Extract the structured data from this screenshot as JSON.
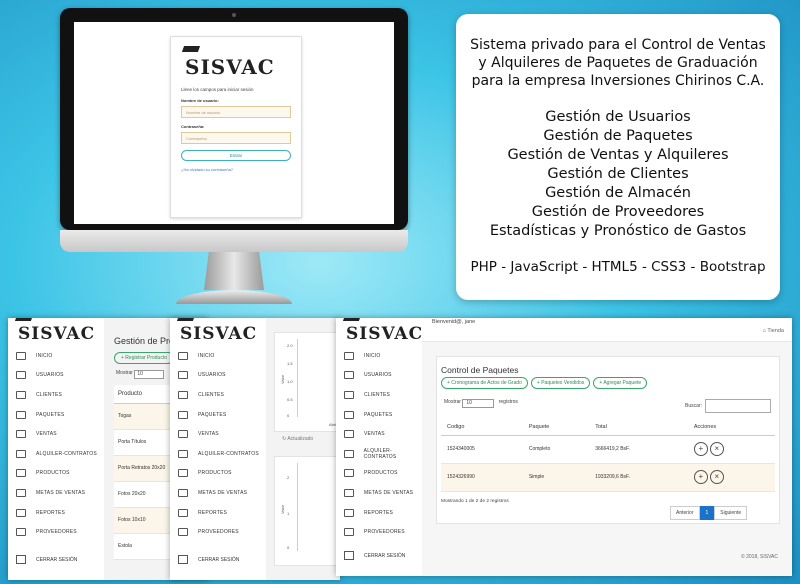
{
  "logo": {
    "text": "SISVAC"
  },
  "login": {
    "hint": "Llene los campos para iniciar sesión",
    "user_label": "Nombre de usuario:",
    "user_placeholder": "Nombre de usuario",
    "pass_label": "Contraseña:",
    "pass_placeholder": "Contraseña",
    "submit_label": "Entrar",
    "forgot_link": "¿Ha olvidado su contraseña?"
  },
  "info": {
    "description": "Sistema privado para el Control de Ventas y Alquileres de Paquetes de Graduación para la empresa Inversiones Chirinos C.A.",
    "features": [
      "Gestión de Usuarios",
      "Gestión de Paquetes",
      "Gestión de Ventas y Alquileres",
      "Gestión de Clientes",
      "Gestión de Almacén",
      "Gestión de Proveedores",
      "Estadísticas y Pronóstico de Gastos"
    ],
    "tech": "PHP - JavaScript - HTML5 - CSS3 - Bootstrap"
  },
  "sidebar": {
    "items": [
      "INICIO",
      "USUARIOS",
      "CLIENTES",
      "PAQUETES",
      "VENTAS",
      "ALQUILER-CONTRATOS",
      "PRODUCTOS",
      "METAS DE VENTAS",
      "REPORTES",
      "PROVEEDORES"
    ],
    "logout": "CERRAR SESIÓN"
  },
  "productos": {
    "title": "Gestión de Productos",
    "add_button": "+ Registrar Producto",
    "show_label": "Mostrar",
    "show_value": "10",
    "column": "Producto",
    "rows": [
      "Togas",
      "Porta Títulos",
      "Porta Retratos 20x20",
      "Fotos 20x20",
      "Fotos 10x10",
      "Estola"
    ]
  },
  "reportes": {
    "axis_label": "Valor",
    "ticks_top": [
      "2.0",
      "1.5",
      "1.0",
      "0.5",
      "0"
    ],
    "ticks_bottom": [
      "2",
      "1",
      "0"
    ],
    "x_label": "Abril",
    "updated": "Actualizado"
  },
  "paquetes": {
    "welcome": "Bienvenid@, jane",
    "store": "Tienda",
    "title": "Control de Paquetes",
    "buttons": [
      "+ Cronograma de Actos de Grado",
      "+ Paquetes Vendidos",
      "+ Agregar Paquete"
    ],
    "show_label": "Mostrar",
    "show_value": "10",
    "show_suffix": "registros",
    "search_label": "Buscar:",
    "columns": [
      "Codigo",
      "Paquete",
      "Total",
      "Acciones"
    ],
    "rows": [
      {
        "codigo": "1524340005",
        "paquete": "Completo",
        "total": "3666419,2 BsF."
      },
      {
        "codigo": "1524326990",
        "paquete": "Simple",
        "total": "1933209,6 BsF."
      }
    ],
    "info": "Mostrando 1 de 2 de 2 registros",
    "pager": [
      "Anterior",
      "1",
      "Siguiente"
    ],
    "footer": "© 2018, SISVAC"
  }
}
